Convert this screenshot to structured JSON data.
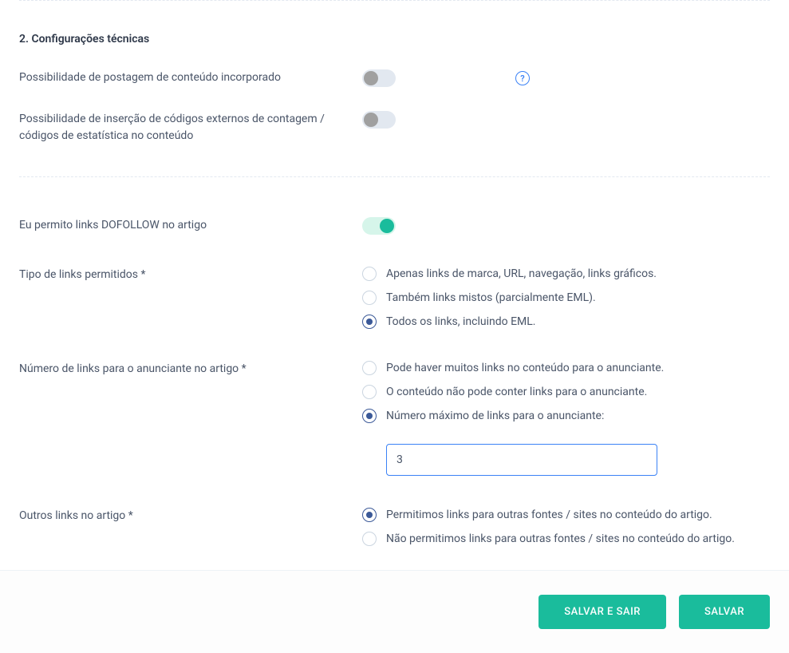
{
  "section": {
    "title": "2. Configurações técnicas"
  },
  "fields": {
    "embedded_content": {
      "label": "Possibilidade de postagem de conteúdo incorporado",
      "enabled": false
    },
    "external_codes": {
      "label": "Possibilidade de inserção de códigos externos de contagem / códigos de estatística no conteúdo",
      "enabled": false
    },
    "dofollow": {
      "label": "Eu permito links DOFOLLOW no artigo",
      "enabled": true
    },
    "link_types": {
      "label": "Tipo de links permitidos *",
      "options": [
        {
          "label": "Apenas links de marca, URL, navegação, links gráficos.",
          "selected": false
        },
        {
          "label": "Também links mistos (parcialmente EML).",
          "selected": false
        },
        {
          "label": "Todos os links, incluindo EML.",
          "selected": true
        }
      ]
    },
    "advertiser_links": {
      "label": "Número de links para o anunciante no artigo *",
      "options": [
        {
          "label": "Pode haver muitos links no conteúdo para o anunciante.",
          "selected": false
        },
        {
          "label": "O conteúdo não pode conter links para o anunciante.",
          "selected": false
        },
        {
          "label": "Número máximo de links para o anunciante:",
          "selected": true
        }
      ],
      "max_value": "3"
    },
    "other_links": {
      "label": "Outros links no artigo *",
      "options": [
        {
          "label": "Permitimos links para outras fontes / sites no conteúdo do artigo.",
          "selected": true
        },
        {
          "label": "Não permitimos links para outras fontes / sites no conteúdo do artigo.",
          "selected": false
        }
      ]
    }
  },
  "footer": {
    "save_exit": "SALVAR E SAIR",
    "save": "SALVAR"
  }
}
